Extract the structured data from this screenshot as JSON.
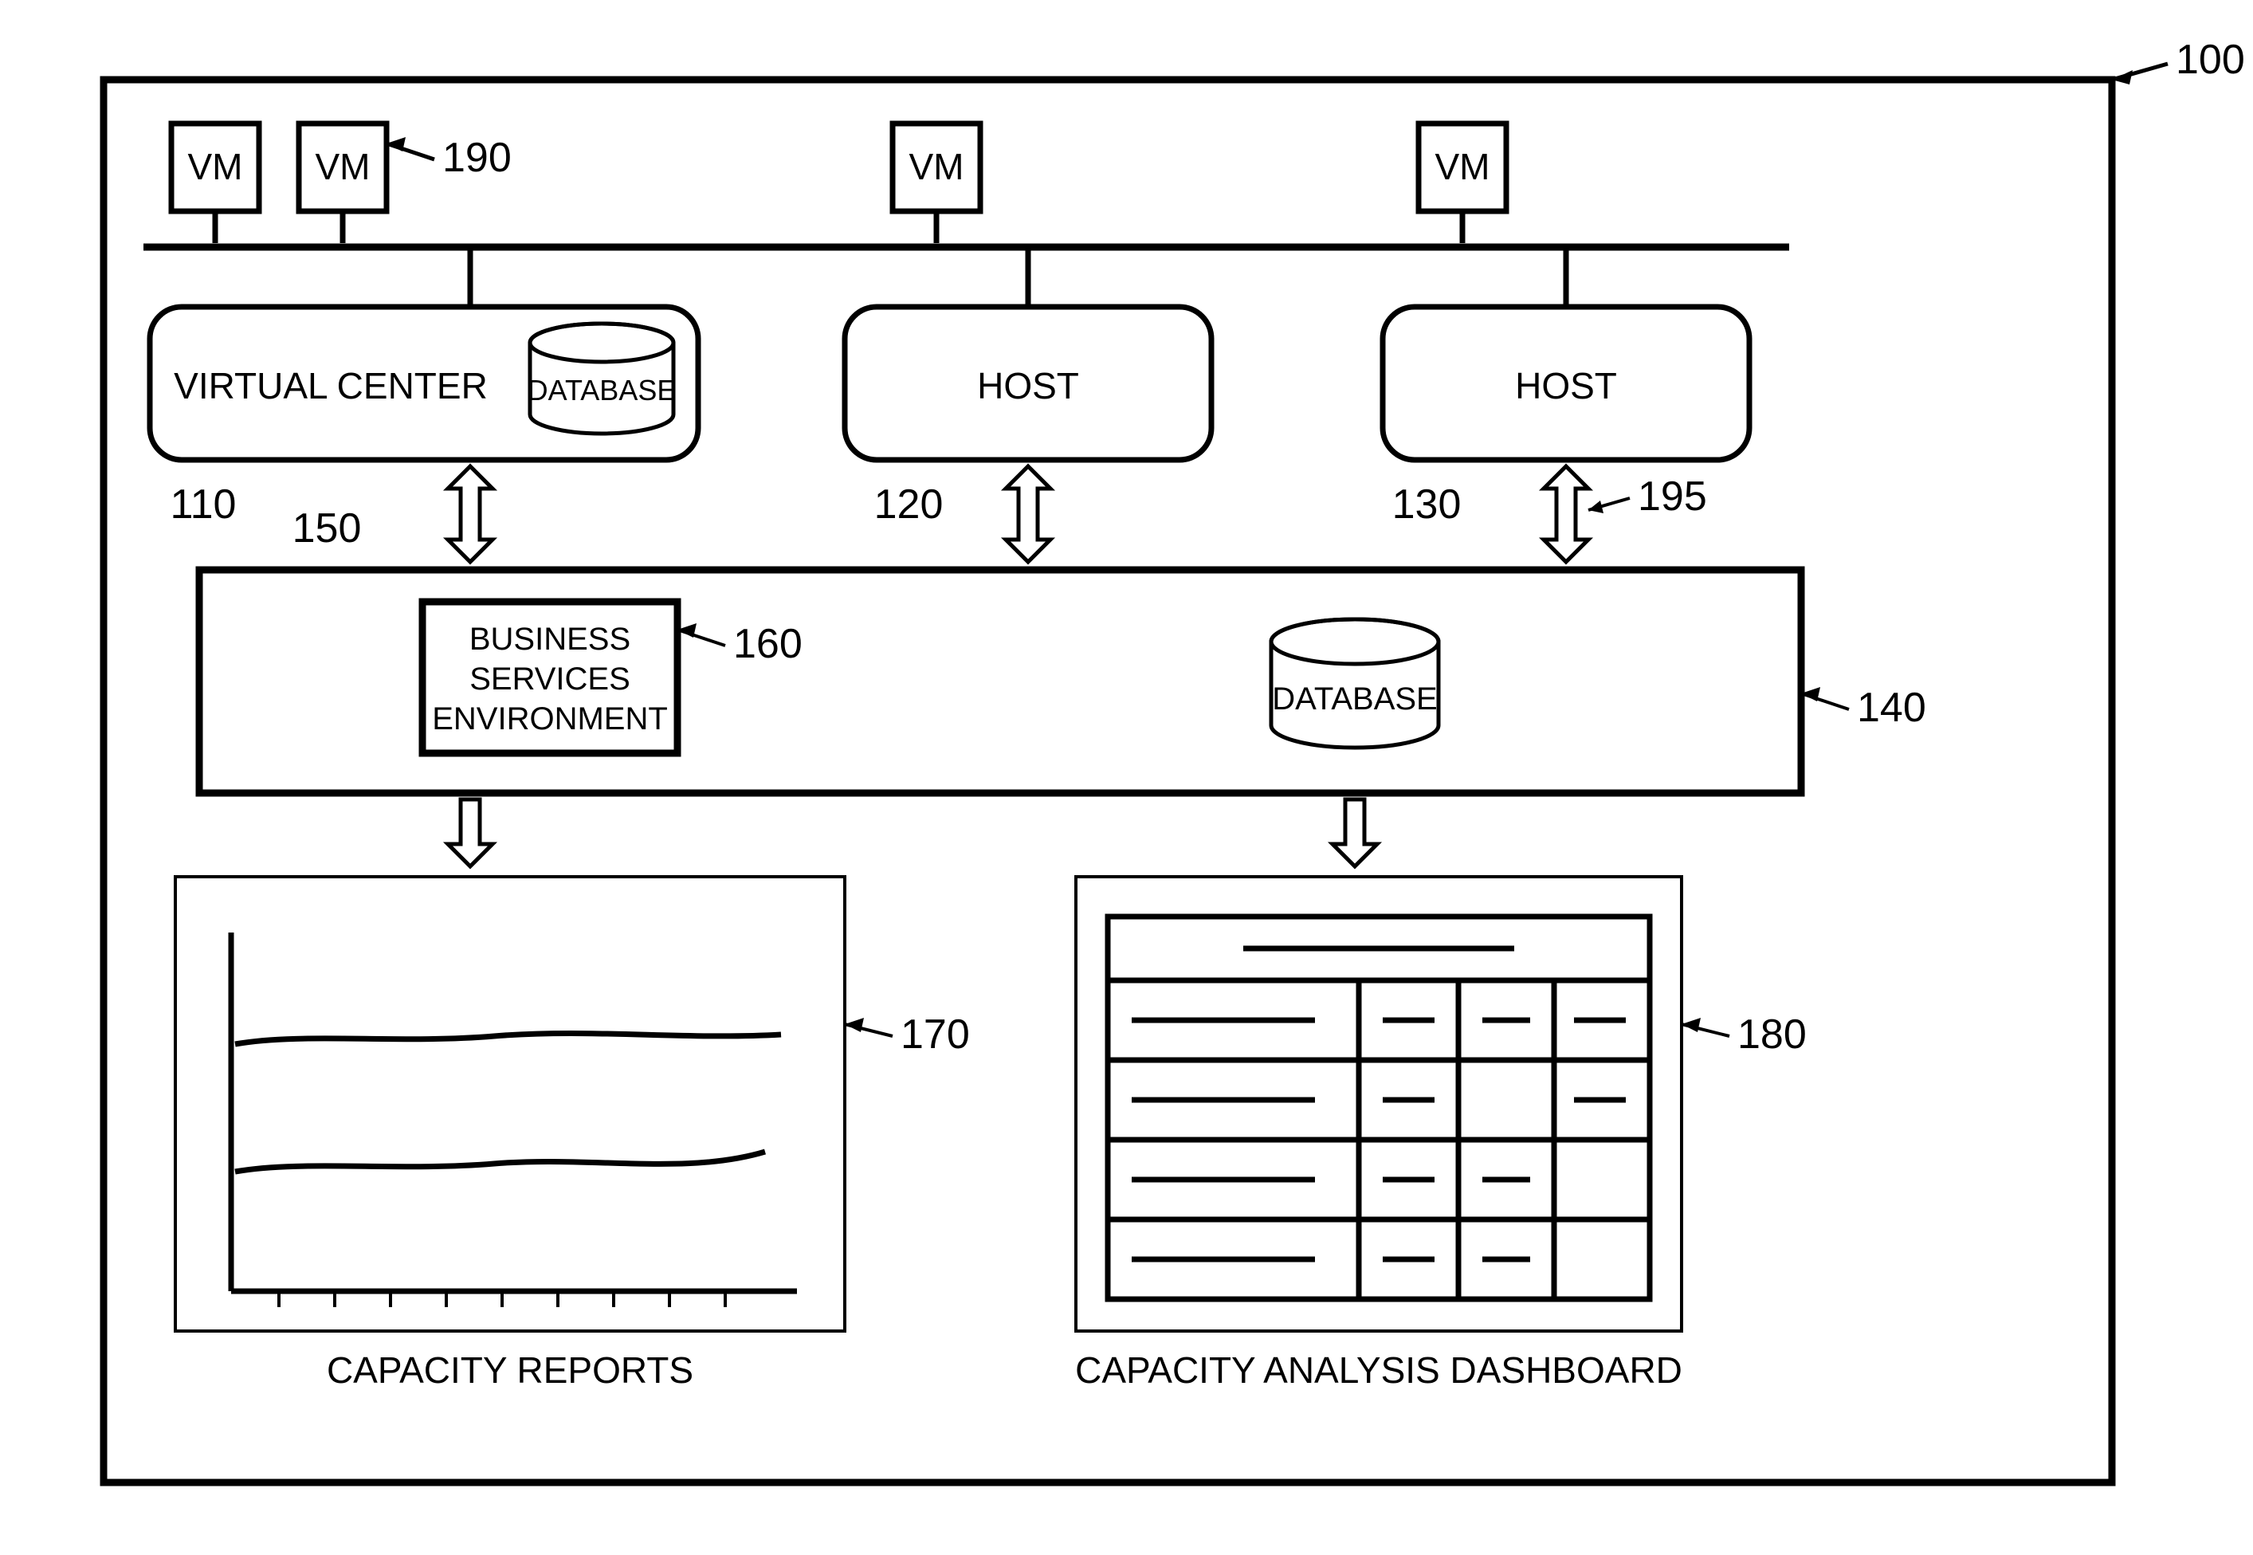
{
  "refs": {
    "system": "100",
    "virtualCenter": "110",
    "host1": "120",
    "host2": "130",
    "midLayer": "140",
    "vcArrow": "150",
    "bse": "160",
    "reports": "170",
    "dashboard": "180",
    "vmRef": "190",
    "hostArrow": "195"
  },
  "labels": {
    "vm": "VM",
    "virtualCenter": "VIRTUAL CENTER",
    "database": "DATABASE",
    "host": "HOST",
    "bse1": "BUSINESS",
    "bse2": "SERVICES",
    "bse3": "ENVIRONMENT",
    "reports": "CAPACITY REPORTS",
    "dashboard": "CAPACITY ANALYSIS DASHBOARD"
  }
}
